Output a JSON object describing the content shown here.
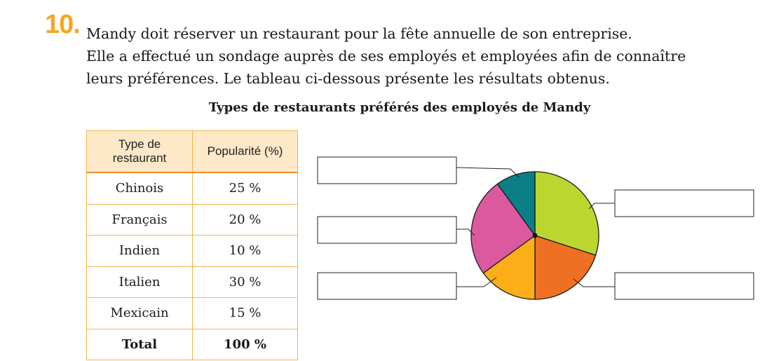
{
  "question": {
    "number": "10.",
    "lines": [
      "Mandy doit réserver un restaurant pour la fête annuelle de son entreprise.",
      "Elle a effectué un sondage auprès de ses employés et employées afin de connaître",
      "leurs préférences. Le tableau ci-dessous présente les résultats obtenus."
    ]
  },
  "chart_data": [
    {
      "type": "table",
      "title": "Types de restaurants préférés des employés de Mandy",
      "columns": [
        "Type de restaurant",
        "Popularité (%)"
      ],
      "rows": [
        {
          "type": "Chinois",
          "popularity": "25 %"
        },
        {
          "type": "Français",
          "popularity": "20 %"
        },
        {
          "type": "Indien",
          "popularity": "10 %"
        },
        {
          "type": "Italien",
          "popularity": "30 %"
        },
        {
          "type": "Mexicain",
          "popularity": "15 %"
        }
      ],
      "total": {
        "label": "Total",
        "value": "100 %"
      }
    },
    {
      "type": "pie",
      "slices": [
        {
          "value": 30,
          "color": "#bcd630"
        },
        {
          "value": 20,
          "color": "#f07023"
        },
        {
          "value": 15,
          "color": "#fbae17"
        },
        {
          "value": 25,
          "color": "#dc59a0"
        },
        {
          "value": 10,
          "color": "#0b7f86"
        }
      ],
      "start": "top",
      "direction": "clockwise",
      "label_boxes": 4,
      "labels": [
        "",
        "",
        "",
        ""
      ]
    }
  ],
  "colors": {
    "accent": "#f5a623",
    "table_border": "#f5b54a",
    "table_header_bg": "#fde8c8",
    "header_rule": "#f08c2a"
  }
}
